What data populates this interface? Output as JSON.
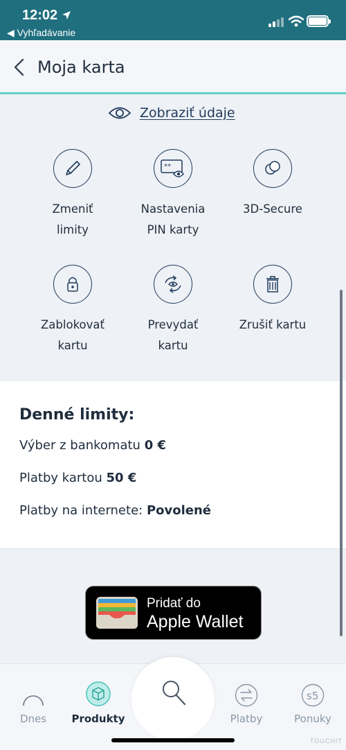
{
  "status_bar": {
    "time": "12:02",
    "back_app": "◀ Vyhľadávanie"
  },
  "header": {
    "title": "Moja karta"
  },
  "show_details": {
    "label": "Zobraziť údaje"
  },
  "actions": [
    {
      "label": "Zmeniť limity",
      "icon": "pencil-icon"
    },
    {
      "label": "Nastavenia PIN karty",
      "icon": "pin-card-icon"
    },
    {
      "label": "3D-Secure",
      "icon": "3d-secure-icon"
    },
    {
      "label": "Zablokovať kartu",
      "icon": "lock-icon"
    },
    {
      "label": "Prevydať kartu",
      "icon": "reissue-icon"
    },
    {
      "label": "Zrušiť kartu",
      "icon": "trash-icon"
    }
  ],
  "limits": {
    "title": "Denné limity:",
    "rows": [
      {
        "label": "Výber z bankomatu",
        "value": "0 €"
      },
      {
        "label": "Platby kartou",
        "value": "50 €"
      },
      {
        "label": "Platby na internete:",
        "value": "Povolené"
      }
    ]
  },
  "wallet": {
    "line1": "Pridať do",
    "line2": "Apple Wallet"
  },
  "tabs": [
    {
      "label": "Dnes",
      "icon": "today-icon",
      "active": false
    },
    {
      "label": "Produkty",
      "icon": "products-icon",
      "active": true
    },
    {
      "label": "",
      "icon": "search-icon",
      "active": false
    },
    {
      "label": "Platby",
      "icon": "transfer-icon",
      "active": false
    },
    {
      "label": "Ponuky",
      "icon": "offers-icon",
      "active": false
    }
  ],
  "offers_badge": "s5",
  "watermark": "TOUCHIT",
  "colors": {
    "status_bar": "#1f6f7e",
    "accent": "#5fd1c6",
    "navy": "#1f3a5c"
  }
}
